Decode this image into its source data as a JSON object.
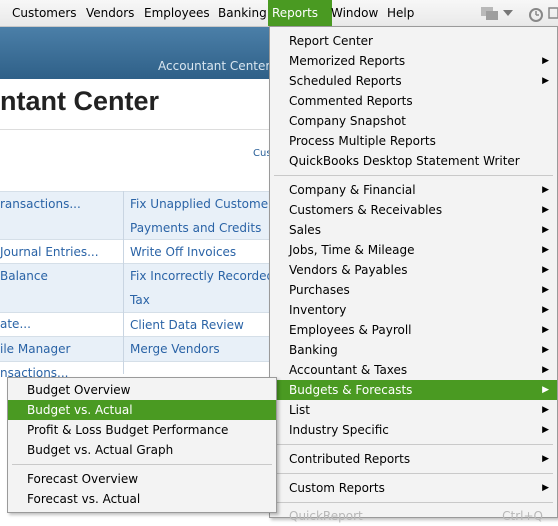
{
  "menubar": {
    "items": [
      {
        "label": "Customers"
      },
      {
        "label": "Vendors"
      },
      {
        "label": "Employees"
      },
      {
        "label": "Banking"
      },
      {
        "label": "Reports"
      },
      {
        "label": "Window"
      },
      {
        "label": "Help"
      }
    ]
  },
  "window": {
    "title_bar_text": "Accountant Center",
    "page_title": "ntant Center",
    "customize_link": "Cus"
  },
  "grid": {
    "left": [
      "ransactions...",
      "Journal Entries...",
      "Balance",
      "ate...",
      "ile Manager",
      "nsactions..."
    ],
    "right": [
      "Fix Unapplied Customer",
      "Payments and Credits",
      "Write Off Invoices",
      "Fix Incorrectly Recorded",
      "Tax",
      "Client Data Review",
      "Merge Vendors"
    ]
  },
  "reports_menu": {
    "items": [
      {
        "label": "Report Center",
        "submenu": false
      },
      {
        "label": "Memorized Reports",
        "submenu": true
      },
      {
        "label": "Scheduled Reports",
        "submenu": true
      },
      {
        "label": "Commented Reports",
        "submenu": false
      },
      {
        "label": "Company Snapshot",
        "submenu": false
      },
      {
        "label": "Process Multiple Reports",
        "submenu": false
      },
      {
        "label": "QuickBooks Desktop Statement Writer",
        "submenu": false
      },
      {
        "label": "Company & Financial",
        "submenu": true
      },
      {
        "label": "Customers & Receivables",
        "submenu": true
      },
      {
        "label": "Sales",
        "submenu": true
      },
      {
        "label": "Jobs, Time & Mileage",
        "submenu": true
      },
      {
        "label": "Vendors & Payables",
        "submenu": true
      },
      {
        "label": "Purchases",
        "submenu": true
      },
      {
        "label": "Inventory",
        "submenu": true
      },
      {
        "label": "Employees & Payroll",
        "submenu": true
      },
      {
        "label": "Banking",
        "submenu": true
      },
      {
        "label": "Accountant & Taxes",
        "submenu": true
      },
      {
        "label": "Budgets & Forecasts",
        "submenu": true,
        "highlighted": true
      },
      {
        "label": "List",
        "submenu": true
      },
      {
        "label": "Industry Specific",
        "submenu": true
      },
      {
        "label": "Contributed Reports",
        "submenu": true
      },
      {
        "label": "Custom Reports",
        "submenu": true
      },
      {
        "label": "QuickReport",
        "shortcut": "Ctrl+Q",
        "disabled": true
      }
    ]
  },
  "budgets_submenu": {
    "items": [
      {
        "label": "Budget Overview"
      },
      {
        "label": "Budget vs. Actual",
        "highlighted": true
      },
      {
        "label": "Profit & Loss Budget Performance"
      },
      {
        "label": "Budget vs. Actual Graph"
      },
      {
        "label": "Forecast Overview"
      },
      {
        "label": "Forecast vs. Actual"
      }
    ]
  },
  "colors": {
    "highlight": "#4a9a22",
    "link": "#2a63a6",
    "title_bar": "#3b6d94"
  }
}
